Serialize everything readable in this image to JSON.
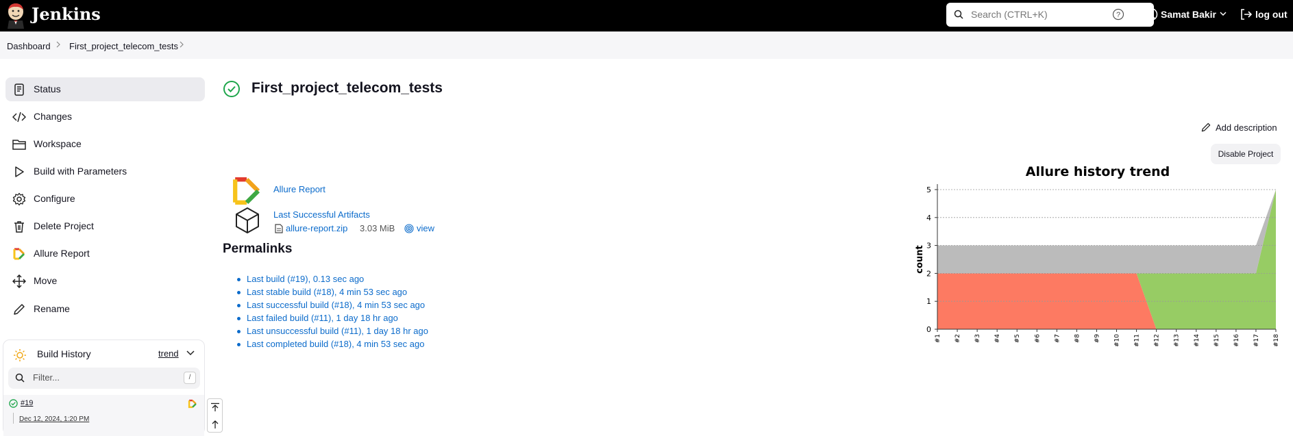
{
  "header": {
    "brand": "Jenkins",
    "search_placeholder": "Search (CTRL+K)",
    "user_name": "Samat Bakir",
    "logout_label": "log out"
  },
  "breadcrumb": [
    "Dashboard",
    "First_project_telecom_tests"
  ],
  "sidebar": {
    "items": [
      {
        "label": "Status",
        "icon": "status-icon"
      },
      {
        "label": "Changes",
        "icon": "code-icon"
      },
      {
        "label": "Workspace",
        "icon": "folder-icon"
      },
      {
        "label": "Build with Parameters",
        "icon": "play-icon"
      },
      {
        "label": "Configure",
        "icon": "gear-icon"
      },
      {
        "label": "Delete Project",
        "icon": "trash-icon"
      },
      {
        "label": "Allure Report",
        "icon": "allure-icon"
      },
      {
        "label": "Move",
        "icon": "move-icon"
      },
      {
        "label": "Rename",
        "icon": "pencil-icon"
      }
    ]
  },
  "build_history": {
    "title": "Build History",
    "trend_label": "trend",
    "filter_placeholder": "Filter...",
    "filter_shortcut": "/",
    "builds": [
      {
        "number": "#19",
        "date": "Dec 12, 2024, 1:20 PM"
      }
    ]
  },
  "main": {
    "title": "First_project_telecom_tests",
    "add_description": "Add description",
    "disable_project": "Disable Project",
    "allure_report": "Allure Report",
    "last_successful_artifacts": "Last Successful Artifacts",
    "artifact_file": "allure-report.zip",
    "artifact_size": "3.03 MiB",
    "artifact_view": "view",
    "permalinks_title": "Permalinks",
    "permalinks": [
      "Last build (#19), 0.13 sec ago",
      "Last stable build (#18), 4 min 53 sec ago",
      "Last successful build (#18), 4 min 53 sec ago",
      "Last failed build (#11), 1 day 18 hr ago",
      "Last unsuccessful build (#11), 1 day 18 hr ago",
      "Last completed build (#18), 4 min 53 sec ago"
    ]
  },
  "colors": {
    "header_bg": "#000000",
    "link": "#0b6bcb",
    "success": "#1ea64b",
    "failed": "#fd7a62",
    "passed": "#97cc64",
    "unknown": "#bbbbbb"
  },
  "chart_data": {
    "type": "area",
    "title": "Allure history trend",
    "ylabel": "count",
    "xlabel": "",
    "categories": [
      "#1",
      "#2",
      "#3",
      "#4",
      "#5",
      "#6",
      "#7",
      "#8",
      "#9",
      "#10",
      "#11",
      "#12",
      "#13",
      "#14",
      "#15",
      "#16",
      "#17",
      "#18"
    ],
    "ylim": [
      0,
      5
    ],
    "yticks": [
      0,
      1,
      2,
      3,
      4,
      5
    ],
    "series": [
      {
        "color": "#fd7a62",
        "values": [
          2,
          2,
          2,
          2,
          2,
          2,
          2,
          2,
          2,
          2,
          2,
          0,
          0,
          0,
          0,
          0,
          0,
          0
        ]
      },
      {
        "color": "#97cc64",
        "values": [
          0,
          0,
          0,
          0,
          0,
          0,
          0,
          0,
          0,
          0,
          0,
          2,
          2,
          2,
          2,
          2,
          2,
          5
        ]
      },
      {
        "color": "#bbbbbb",
        "values": [
          1,
          1,
          1,
          1,
          1,
          1,
          1,
          1,
          1,
          1,
          1,
          1,
          1,
          1,
          1,
          1,
          1,
          0
        ]
      }
    ],
    "grid": true,
    "legend": "none"
  }
}
